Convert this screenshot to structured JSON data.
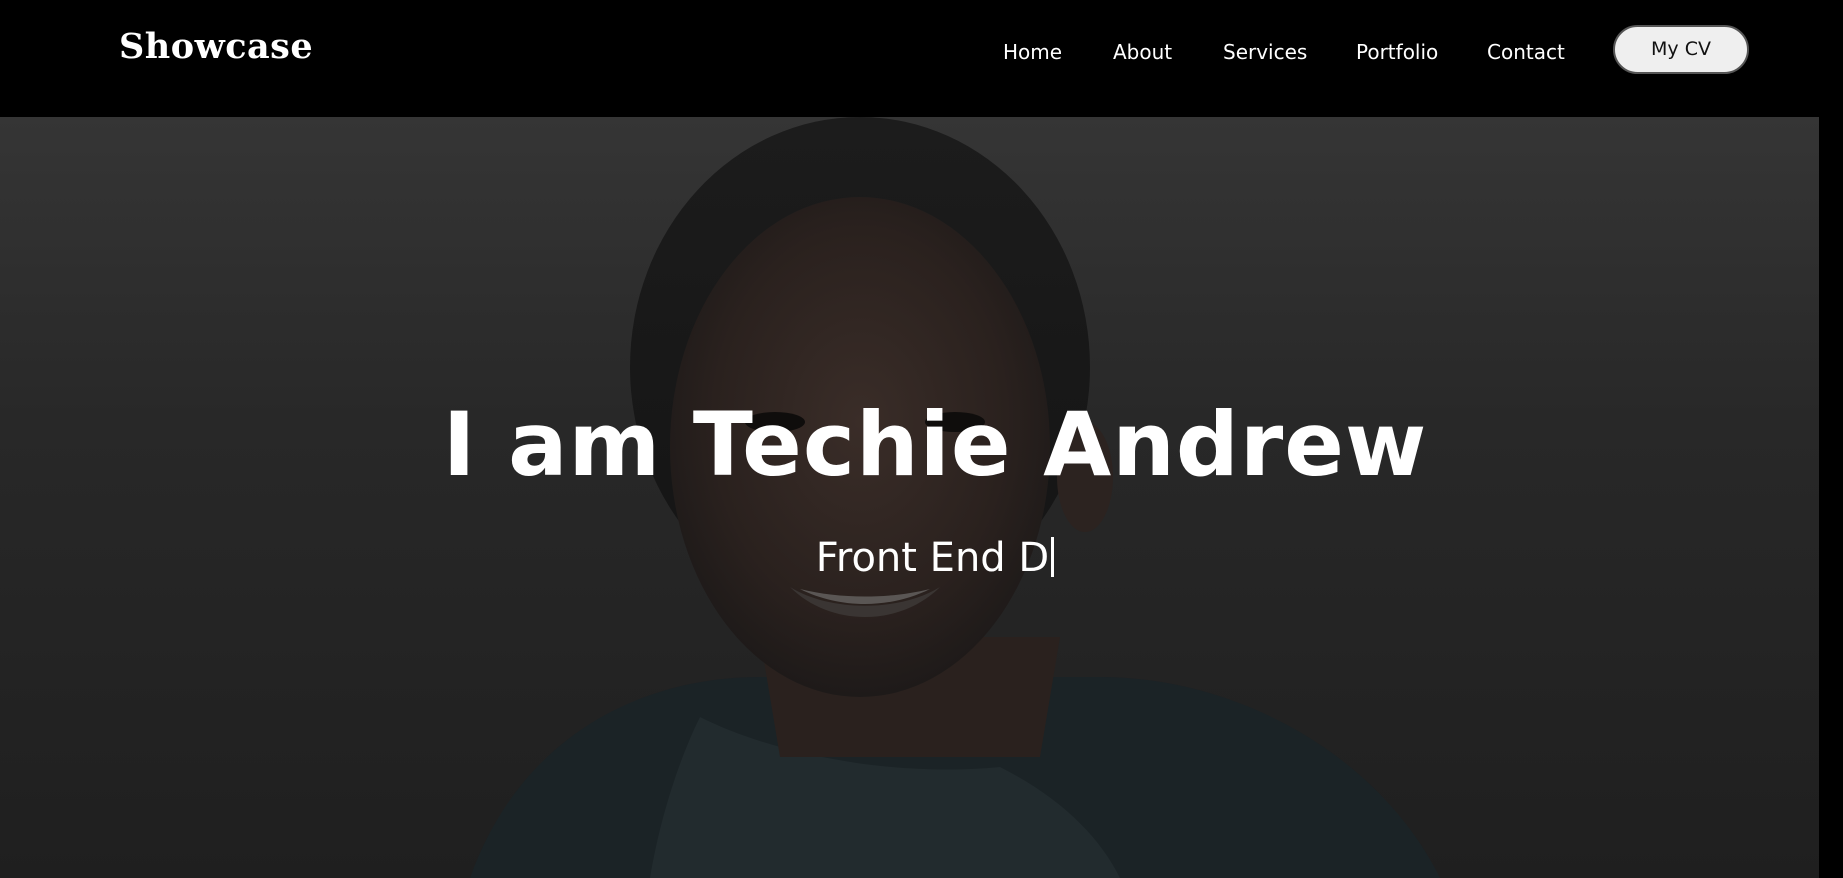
{
  "header": {
    "logo": "Showcase",
    "nav": [
      {
        "label": "Home"
      },
      {
        "label": "About"
      },
      {
        "label": "Services"
      },
      {
        "label": "Portfolio"
      },
      {
        "label": "Contact"
      }
    ],
    "cv_button_label": "My CV"
  },
  "hero": {
    "title": "I am Techie Andrew",
    "typed_subtitle": "Front End D"
  },
  "colors": {
    "header_bg": "#000000",
    "hero_overlay": "#2a2a2a",
    "text": "#ffffff",
    "cv_button_bg": "#efefef"
  }
}
